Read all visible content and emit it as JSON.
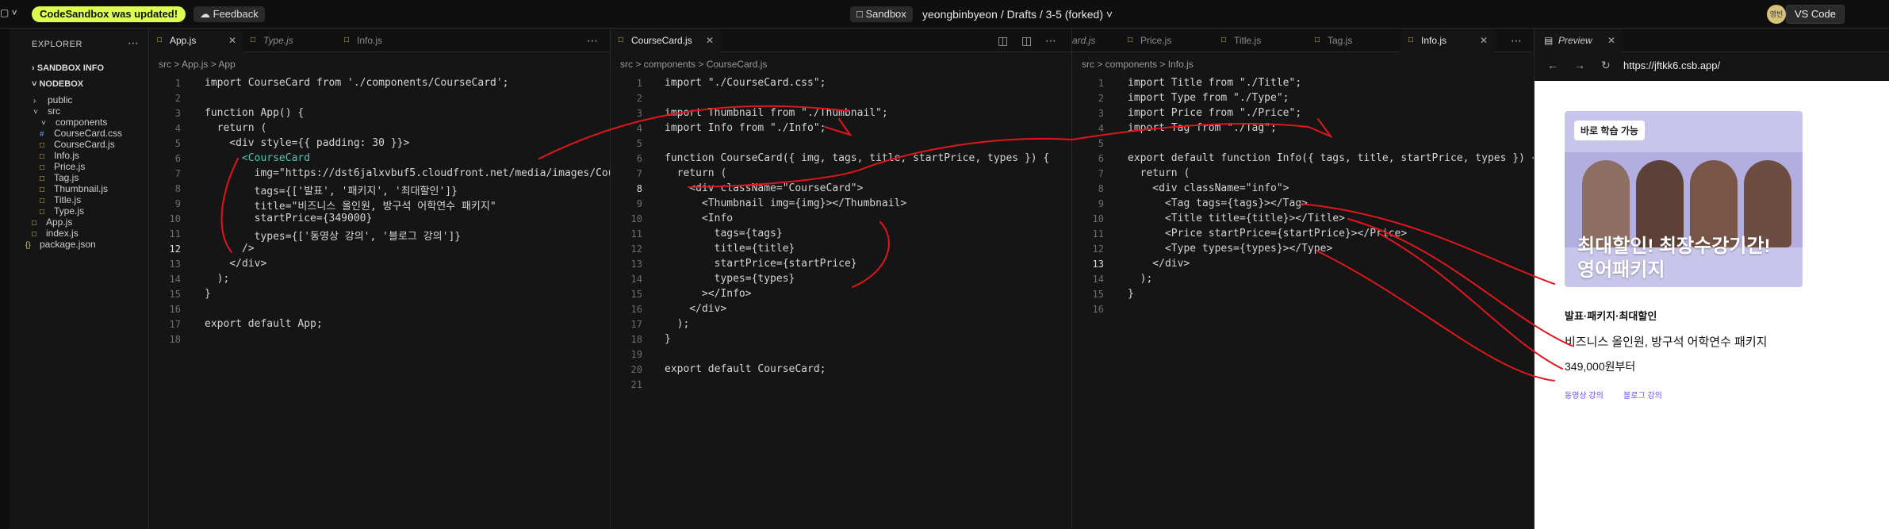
{
  "topbar": {
    "update_badge": "CodeSandbox was updated!",
    "feedback": "Feedback",
    "sandbox_tag": "Sandbox",
    "path": "yeongbinbyeon / Drafts / 3-5 (forked)",
    "avatar_text": "영빈",
    "vscode_button": "VS Code"
  },
  "explorer": {
    "title": "EXPLORER",
    "sandbox_info": "SANDBOX INFO",
    "project": "NODEBOX",
    "items": [
      {
        "label": "public"
      },
      {
        "label": "src"
      },
      {
        "label": "components"
      },
      {
        "label": "CourseCard.css"
      },
      {
        "label": "CourseCard.js"
      },
      {
        "label": "Info.js"
      },
      {
        "label": "Price.js"
      },
      {
        "label": "Tag.js"
      },
      {
        "label": "Thumbnail.js"
      },
      {
        "label": "Title.js"
      },
      {
        "label": "Type.js"
      },
      {
        "label": "App.js"
      },
      {
        "label": "index.js"
      },
      {
        "label": "package.json"
      }
    ]
  },
  "pane1": {
    "tabs": [
      "App.js",
      "Type.js",
      "Info.js"
    ],
    "breadcrumb": "src  >  App.js  >  App",
    "lines": [
      "import CourseCard from './components/CourseCard';",
      "",
      "function App() {",
      "  return (",
      "    <div style={{ padding: 30 }}>",
      "      <CourseCard",
      "        img=\"https://dst6jalxvbuf5.cloudfront.net/media/images/Cour",
      "        tags={['발표', '패키지', '최대할인']}",
      "        title=\"비즈니스 올인원, 방구석 어학연수 패키지\"",
      "        startPrice={349000}",
      "        types={['동영상 강의', '블로그 강의']}",
      "      />",
      "    </div>",
      "  );",
      "}",
      "",
      "export default App;",
      ""
    ]
  },
  "pane2": {
    "tabs": [
      "CourseCard.js"
    ],
    "breadcrumb": "src  >  components  >  CourseCard.js",
    "lines": [
      "import \"./CourseCard.css\";",
      "",
      "import Thumbnail from \"./Thumbnail\";",
      "import Info from \"./Info\";",
      "",
      "function CourseCard({ img, tags, title, startPrice, types }) {",
      "  return (",
      "    <div className=\"CourseCard\">",
      "      <Thumbnail img={img}></Thumbnail>",
      "      <Info",
      "        tags={tags}",
      "        title={title}",
      "        startPrice={startPrice}",
      "        types={types}",
      "      ></Info>",
      "    </div>",
      "  );",
      "}",
      "",
      "export default CourseCard;",
      ""
    ]
  },
  "pane3": {
    "tabs": [
      "ard.js",
      "Price.js",
      "Title.js",
      "Tag.js",
      "Info.js"
    ],
    "breadcrumb": "src  >  components  >  Info.js",
    "lines": [
      "import Title from \"./Title\";",
      "import Type from \"./Type\";",
      "import Price from \"./Price\";",
      "import Tag from \"./Tag\";",
      "",
      "export default function Info({ tags, title, startPrice, types }) {",
      "  return (",
      "    <div className=\"info\">",
      "      <Tag tags={tags}></Tag>",
      "      <Title title={title}></Title>",
      "      <Price startPrice={startPrice}></Price>",
      "      <Type types={types}></Type>",
      "    </div>",
      "  );",
      "}",
      ""
    ]
  },
  "preview": {
    "tab": "Preview",
    "url": "https://jftkk6.csb.app/",
    "chip": "바로 학습 가능",
    "headline1": "최대할인! 최장수강기간!",
    "headline2": "영어패키지",
    "tags": "발표·패키지·최대할인",
    "title": "비즈니스 올인원, 방구석 어학연수 패키지",
    "price": "349,000원부터",
    "types": [
      "동영상 강의",
      "블로그 강의"
    ]
  },
  "colors": {
    "accent_update": "#dcff50",
    "annotation_red": "#e0161b",
    "type_link": "#6b4cf6"
  }
}
